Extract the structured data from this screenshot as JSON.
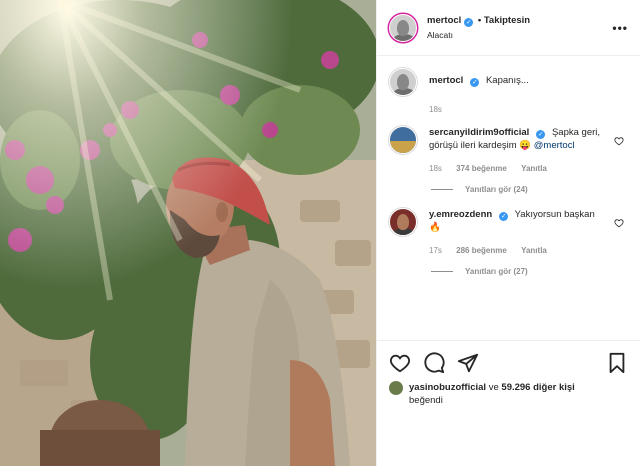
{
  "header": {
    "username": "mertocl",
    "follow_label": "Takiptesin",
    "location": "Alacatı",
    "more_glyph": "•••"
  },
  "caption": {
    "username": "mertocl",
    "text": "Kapanış...",
    "time": "18s"
  },
  "comments": [
    {
      "username": "sercanyildirim9official",
      "text": "Şapka geri, görüşü ileri kardeşim 😛",
      "mention": "@mertocl",
      "time": "18s",
      "likes": "374 beğenme",
      "reply_label": "Yanıtla",
      "view_replies": "Yanıtları gör (24)"
    },
    {
      "username": "y.emreozdenn",
      "text": "Yakıyorsun başkan🔥",
      "mention": "",
      "time": "17s",
      "likes": "286 beğenme",
      "reply_label": "Yanıtla",
      "view_replies": "Yanıtları gör (27)"
    }
  ],
  "likes": {
    "liker": "yasinobuzofficial",
    "connector": "ve",
    "count": "59.296 diğer kişi",
    "suffix": "beğendi"
  },
  "icons": {
    "verified_glyph": "✓"
  },
  "colors": {
    "verified": "#3897f0",
    "text": "#262626",
    "muted": "#8e8e8e",
    "link": "#00376b"
  }
}
